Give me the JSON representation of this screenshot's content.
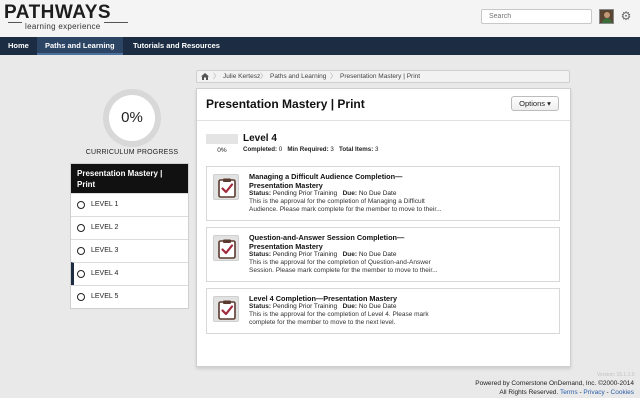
{
  "header": {
    "logo_main": "PATHWAYS",
    "logo_sub": "learning experience",
    "search_placeholder": "Search",
    "avatar_icon": "user-avatar",
    "settings_icon": "gear-icon"
  },
  "nav": {
    "items": [
      {
        "label": "Home"
      },
      {
        "label": "Paths and Learning"
      },
      {
        "label": "Tutorials and Resources"
      }
    ],
    "active_index": 1,
    "colors": {
      "bar": "#1c2c42",
      "active": "#2d4565"
    }
  },
  "progress": {
    "value_label": "0%",
    "value": 0,
    "label": "CURRICULUM PROGRESS"
  },
  "curriculum": {
    "title": "Presentation Mastery | Print",
    "levels": [
      {
        "label": "LEVEL 1"
      },
      {
        "label": "LEVEL 2"
      },
      {
        "label": "LEVEL 3"
      },
      {
        "label": "LEVEL 4"
      },
      {
        "label": "LEVEL 5"
      }
    ],
    "selected_index": 3
  },
  "breadcrumb": {
    "home_icon": "home-icon",
    "items": [
      "Julie Kertesz",
      "Paths and Learning",
      "Presentation Mastery | Print"
    ]
  },
  "main": {
    "title": "Presentation Mastery | Print",
    "options_label": "Options",
    "level": {
      "name": "Level 4",
      "pct_label": "0%",
      "completed_label": "Completed:",
      "completed": "0",
      "min_required_label": "Min Required:",
      "min_required": "3",
      "total_label": "Total Items:",
      "total": "3"
    },
    "items": [
      {
        "title_l1": "Managing a Difficult Audience Completion—",
        "title_l2": "Presentation Mastery",
        "status_label": "Status:",
        "status": "Pending Prior Training",
        "due_label": "Due:",
        "due": "No Due Date",
        "desc_l1": "This is the approval for the completion of Managing a Difficult",
        "desc_l2": "Audience. Please mark complete for the member to move to their..."
      },
      {
        "title_l1": "Question-and-Answer Session Completion—",
        "title_l2": "Presentation Mastery",
        "status_label": "Status:",
        "status": "Pending Prior Training",
        "due_label": "Due:",
        "due": "No Due Date",
        "desc_l1": "This is the approval for the completion of Question-and-Answer",
        "desc_l2": "Session. Please mark complete for the member to move to their..."
      },
      {
        "title_l1": "Level 4 Completion—Presentation Mastery",
        "status_label": "Status:",
        "status": "Pending Prior Training",
        "due_label": "Due:",
        "due": "No Due Date",
        "desc_l1": "This is the approval for the completion of Level 4. Please mark",
        "desc_l2": "complete for the member to move to the next level."
      }
    ]
  },
  "footer": {
    "version": "Version: 15.1.1.0",
    "powered": "Powered by Cornerstone OnDemand, Inc. ©2000-2014",
    "rights": "All Rights Reserved.",
    "terms": "Terms",
    "privacy": "Privacy",
    "cookies": "Cookies",
    "sep": " - "
  }
}
